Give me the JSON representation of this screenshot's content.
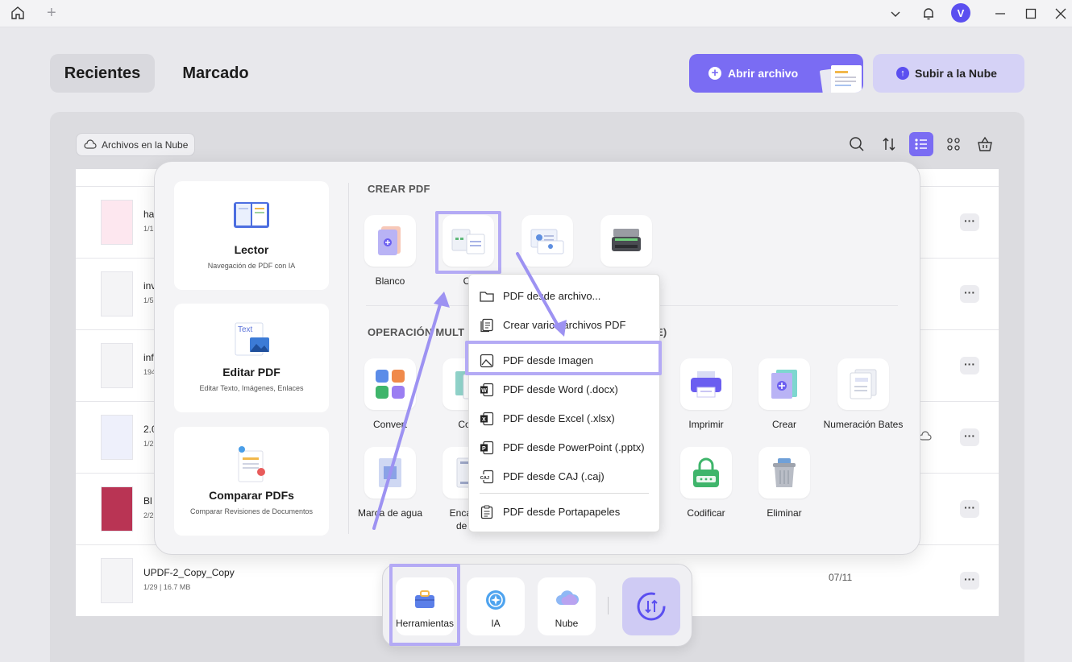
{
  "titlebar": {
    "icons": [
      "home-icon",
      "plus-icon",
      "chevron-down-icon",
      "bell-icon",
      "minimize-icon",
      "maximize-icon",
      "close-icon"
    ],
    "avatar_letter": "V"
  },
  "tabs": [
    {
      "label": "Recientes",
      "active": true
    },
    {
      "label": "Marcado",
      "active": false
    }
  ],
  "actions": {
    "open_file": "Abrir archivo",
    "upload_cloud": "Subir a la Nube"
  },
  "filter_chip": "Archivos en la Nube",
  "toolbar_icons": [
    "search-icon",
    "sort-icon",
    "list-view-icon",
    "grid-view-icon",
    "basket-icon"
  ],
  "files": [
    {
      "name": "ha",
      "meta": "1/1"
    },
    {
      "name": "inv",
      "meta": "1/5"
    },
    {
      "name": "inf",
      "meta": "194"
    },
    {
      "name": "2.0",
      "meta": "1/2"
    },
    {
      "name": "Bl",
      "meta": "2/2"
    },
    {
      "name": "UPDF-2_Copy_Copy",
      "meta": "1/29 | 16.7 MB",
      "date": "07/11"
    }
  ],
  "tools_panel": {
    "cards": [
      {
        "title": "Lector",
        "subtitle": "Navegación de PDF con IA"
      },
      {
        "title": "Editar PDF",
        "subtitle": "Editar Texto, Imágenes, Enlaces"
      },
      {
        "title": "Comparar PDFs",
        "subtitle": "Comparar Revisiones de Documentos"
      }
    ],
    "create_section_title": "CREAR PDF",
    "create_tiles": [
      {
        "label": "Blanco",
        "icon": "blank-page-icon"
      },
      {
        "label": "Ot",
        "icon": "other-files-icon"
      },
      {
        "label": "",
        "icon": "id-card-icon"
      },
      {
        "label": "",
        "icon": "scanner-icon"
      }
    ],
    "batch_section_title_left": "OPERACIÓN MULT",
    "batch_section_title_right": "E)",
    "batch_tiles": [
      {
        "label": "Convert",
        "icon": "convert-icon"
      },
      {
        "label": "Com",
        "icon": "combine-icon"
      },
      {
        "label": "Imprimir",
        "icon": "printer-icon"
      },
      {
        "label": "Crear",
        "icon": "create-icon"
      },
      {
        "label": "Numeración Bates",
        "icon": "bates-numbering-icon"
      },
      {
        "label": "Marca de agua",
        "icon": "watermark-icon"
      },
      {
        "label": "Encabez",
        "label2": "de pa",
        "icon": "header-footer-icon"
      },
      {
        "label": "Codificar",
        "icon": "encrypt-icon"
      },
      {
        "label": "Eliminar",
        "icon": "trash-icon"
      }
    ]
  },
  "dropdown": {
    "items": [
      {
        "label": "PDF desde archivo...",
        "icon": "folder-icon"
      },
      {
        "label": "Crear varios archivos PDF",
        "icon": "multi-file-icon"
      },
      {
        "label": "PDF desde Imagen",
        "icon": "image-icon",
        "highlighted": true
      },
      {
        "label": "PDF desde Word (.docx)",
        "icon": "word-icon"
      },
      {
        "label": "PDF desde Excel (.xlsx)",
        "icon": "excel-icon"
      },
      {
        "label": "PDF desde PowerPoint (.pptx)",
        "icon": "powerpoint-icon"
      },
      {
        "label": "PDF desde CAJ (.caj)",
        "icon": "caj-icon"
      },
      {
        "label": "PDF desde Portapapeles",
        "icon": "clipboard-icon"
      }
    ]
  },
  "dock": {
    "items": [
      {
        "label": "Herramientas",
        "icon": "toolbox-icon",
        "highlighted": true
      },
      {
        "label": "IA",
        "icon": "ai-icon"
      },
      {
        "label": "Nube",
        "icon": "cloud-icon"
      }
    ],
    "sync_icon": "sync-icon"
  },
  "colors": {
    "accent": "#7a6cf3",
    "highlight": "#b4aaf5",
    "arrow": "#9d92f2"
  }
}
